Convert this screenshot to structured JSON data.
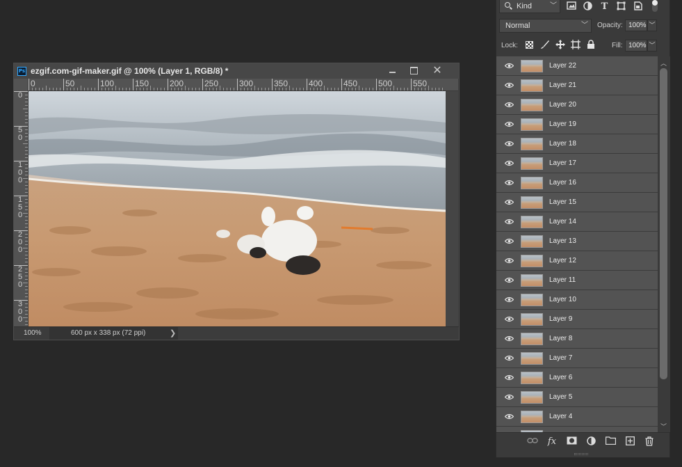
{
  "document": {
    "title": "ezgif.com-gif-maker.gif @ 100% (Layer 1, RGB/8) *",
    "app_badge": "Ps",
    "ruler_h_labels": [
      "0",
      "50",
      "100",
      "150",
      "200",
      "250",
      "300",
      "350",
      "400",
      "450",
      "500",
      "550"
    ],
    "ruler_v_labels": [
      "0",
      "50",
      "100",
      "150",
      "200",
      "250",
      "300"
    ],
    "status_zoom": "100%",
    "status_info": "600 px x 338 px (72 ppi)",
    "status_arrow": "❯",
    "window_buttons": {
      "minimize": "minimize",
      "maximize": "maximize",
      "close": "✕"
    }
  },
  "layers_panel": {
    "filter_kind": "Kind",
    "filter_icons": [
      "image-filter-icon",
      "adjustment-filter-icon",
      "type-filter-icon",
      "shape-filter-icon",
      "smart-object-filter-icon"
    ],
    "blend_mode": "Normal",
    "opacity_label": "Opacity:",
    "opacity_value": "100%",
    "lock_label": "Lock:",
    "fill_label": "Fill:",
    "fill_value": "100%",
    "layers": [
      "Layer 22",
      "Layer 21",
      "Layer 20",
      "Layer 19",
      "Layer 18",
      "Layer 17",
      "Layer 16",
      "Layer 15",
      "Layer 14",
      "Layer 13",
      "Layer 12",
      "Layer 11",
      "Layer 10",
      "Layer 9",
      "Layer 8",
      "Layer 7",
      "Layer 6",
      "Layer 5",
      "Layer 4"
    ],
    "bottom_icons": [
      "link-layers-icon",
      "fx-icon",
      "add-mask-icon",
      "adjustment-layer-icon",
      "new-group-icon",
      "new-layer-icon",
      "delete-layer-icon"
    ]
  },
  "colors": {
    "app_bg": "#282828",
    "panel_bg": "#3a3a3a",
    "layer_row_bg": "#535353",
    "ps_accent": "#31a8ff"
  }
}
